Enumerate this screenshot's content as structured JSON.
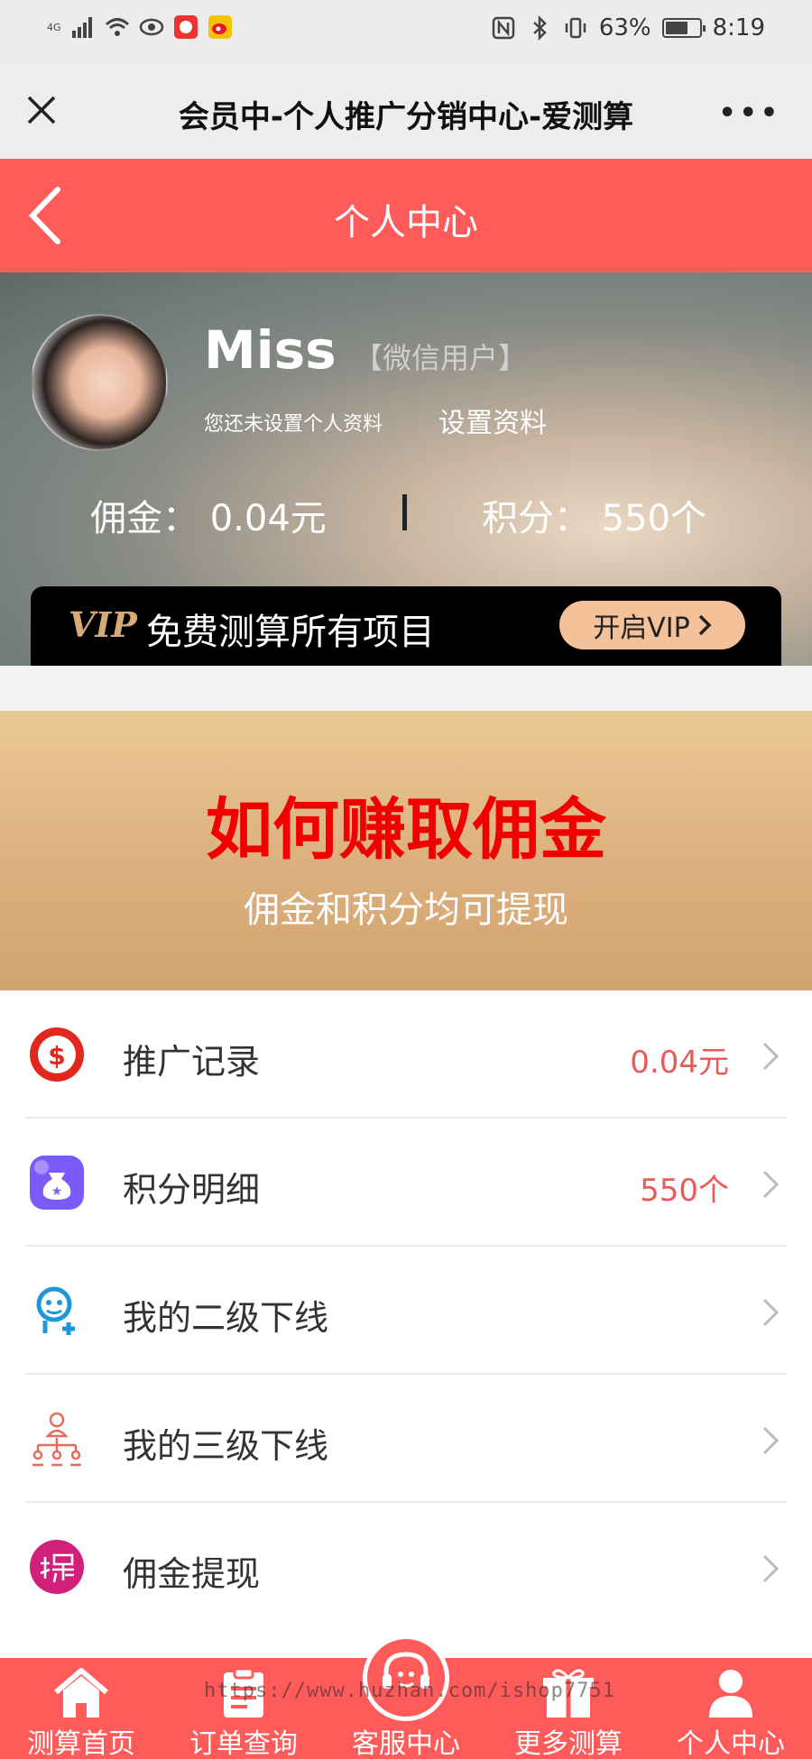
{
  "status_bar": {
    "network": "4G",
    "battery": "63%",
    "battery_level": 0.63,
    "time": "8:19"
  },
  "webview": {
    "title": "会员中-个人推广分销中心-爱测算",
    "close_icon": "close-icon",
    "more_icon": "more-icon"
  },
  "header": {
    "title": "个人中心"
  },
  "profile": {
    "username": "Miss",
    "user_tag": "【微信用户】",
    "hint": "您还未设置个人资料",
    "setup_link": "设置资料",
    "commission_label": "佣金：",
    "commission_value": "0.04元",
    "points_label": "积分：",
    "points_value": "550个"
  },
  "vip": {
    "logo": "VIP",
    "text": "免费测算所有项目",
    "button": "开启VIP"
  },
  "promo": {
    "title": "如何赚取佣金",
    "subtitle": "佣金和积分均可提现"
  },
  "menu": [
    {
      "label": "推广记录",
      "value": "0.04元",
      "icon": "dollar-icon"
    },
    {
      "label": "积分明细",
      "value": "550个",
      "icon": "money-bag-icon"
    },
    {
      "label": "我的二级下线",
      "value": "",
      "icon": "add-user-icon"
    },
    {
      "label": "我的三级下线",
      "value": "",
      "icon": "org-chart-icon"
    },
    {
      "label": "佣金提现",
      "value": "",
      "icon": "withdraw-icon"
    }
  ],
  "tabbar": {
    "items": [
      {
        "label": "测算首页",
        "icon": "home-icon"
      },
      {
        "label": "订单查询",
        "icon": "clipboard-icon"
      },
      {
        "label": "客服中心",
        "icon": "headset-icon"
      },
      {
        "label": "更多测算",
        "icon": "gift-icon"
      },
      {
        "label": "个人中心",
        "icon": "person-icon"
      }
    ],
    "watermark": "https://www.huzhan.com/ishop7751"
  },
  "colors": {
    "header_red": "#ff5b5b",
    "promo_red": "#f00000",
    "value_red": "#e85b58",
    "vip_gold": "#f3c29a"
  }
}
